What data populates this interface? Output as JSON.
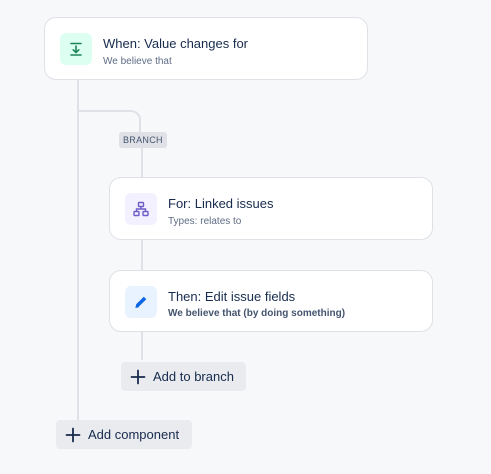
{
  "trigger": {
    "title": "When: Value changes for",
    "subtitle": "We believe that",
    "icon": "download-arrow-icon",
    "color": "#1f845a"
  },
  "branch": {
    "badge": "BRANCH",
    "for_card": {
      "title": "For: Linked issues",
      "subtitle": "Types: relates to",
      "icon": "hierarchy-icon",
      "color": "#6e5dc6"
    },
    "then_card": {
      "title": "Then: Edit issue fields",
      "subtitle": "We believe that (by doing something)",
      "icon": "pencil-icon",
      "color": "#0c66e4"
    },
    "add_label": "Add to branch"
  },
  "add_component_label": "Add component"
}
